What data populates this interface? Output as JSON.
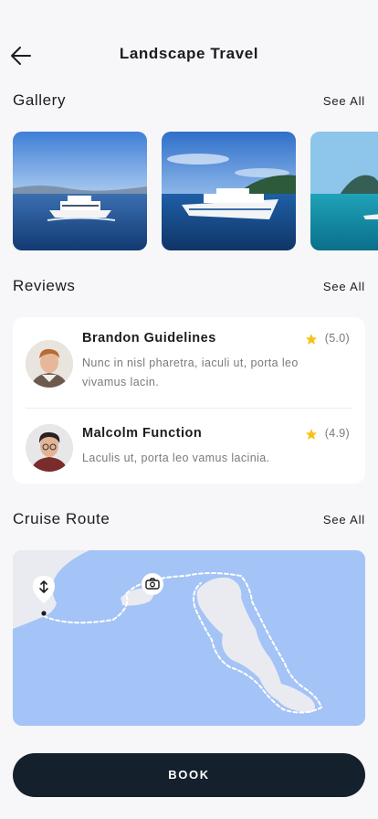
{
  "header": {
    "title": "Landscape Travel"
  },
  "gallery": {
    "title": "Gallery",
    "see_all": "See All"
  },
  "reviews": {
    "title": "Reviews",
    "see_all": "See All",
    "items": [
      {
        "name": "Brandon Guidelines",
        "rating": "(5.0)",
        "text": "Nunc in nisl pharetra, iaculi ut, porta leo vivamus lacin."
      },
      {
        "name": "Malcolm Function",
        "rating": "(4.9)",
        "text": "Laculis ut, porta leo vamus lacinia."
      }
    ]
  },
  "route": {
    "title": "Cruise Route",
    "see_all": "See All"
  },
  "book": {
    "label": "BOOK"
  },
  "icons": {
    "back": "arrow-left-icon",
    "star": "star-icon",
    "location": "location-pin-icon",
    "camera": "camera-icon"
  },
  "colors": {
    "accent_dark": "#14212c",
    "star": "#f7c21a",
    "map_water": "#a4c3f6",
    "map_land": "#e9ebf0"
  }
}
